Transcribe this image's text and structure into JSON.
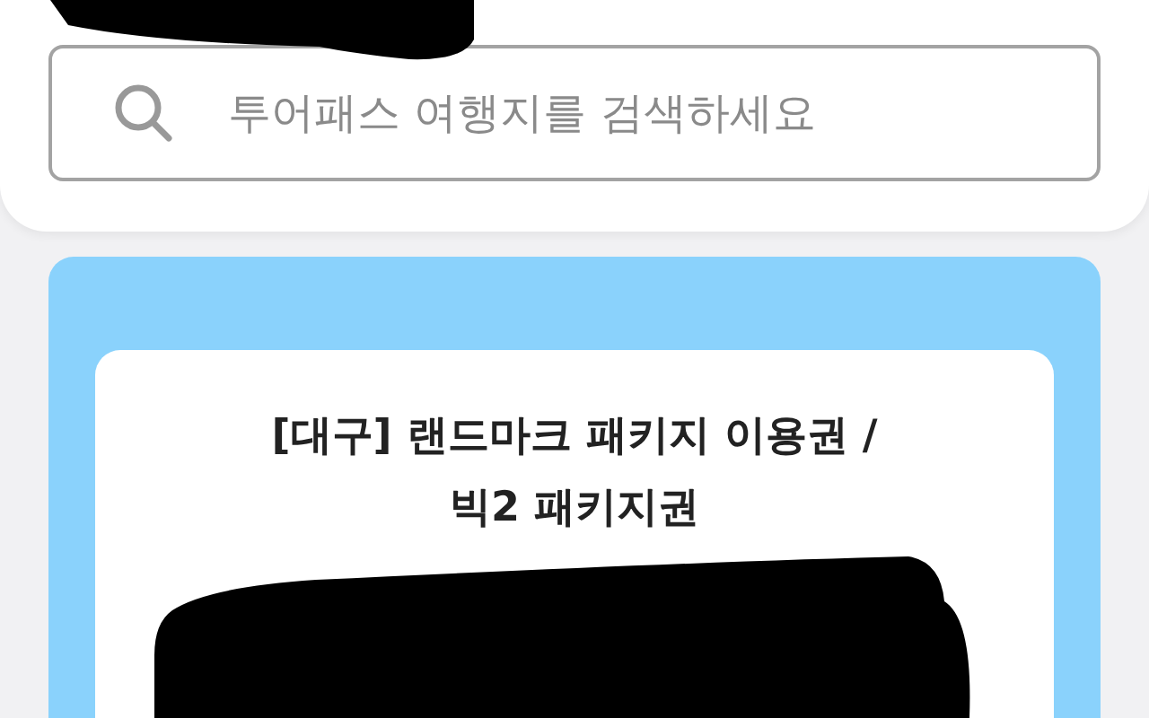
{
  "search": {
    "placeholder": "투어패스 여행지를 검색하세요"
  },
  "product": {
    "title_lines": [
      "[대구] 랜드마크 패키지 이용권 /",
      "빅2 패키지권"
    ]
  }
}
